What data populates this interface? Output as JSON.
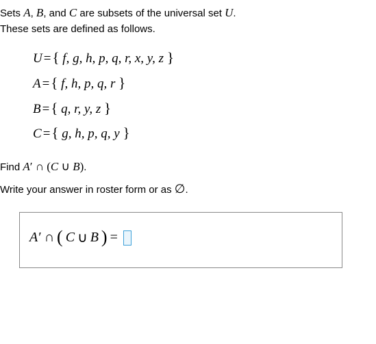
{
  "intro": {
    "line1_pre": "Sets ",
    "A": "A",
    "sep1": ", ",
    "B": "B",
    "sep2": ", and ",
    "C": "C",
    "line1_post": " are subsets of the universal set ",
    "U": "U",
    "period": ".",
    "line2": "These sets are defined as follows."
  },
  "sets": {
    "U": {
      "name": "U",
      "eq": "=",
      "lb": "{",
      "elems": " f, g, h, p, q, r, x, y, z ",
      "rb": "}"
    },
    "A": {
      "name": "A",
      "eq": "=",
      "lb": "{",
      "elems": " f, h, p, q, r ",
      "rb": "}"
    },
    "B": {
      "name": "B",
      "eq": "=",
      "lb": "{",
      "elems": " q, r, y, z ",
      "rb": "}"
    },
    "C": {
      "name": "C",
      "eq": "=",
      "lb": "{",
      "elems": " g, h, p, q, y ",
      "rb": "}"
    }
  },
  "prompt": {
    "find_pre": "Find ",
    "expr_A": "A",
    "prime": "′",
    "cap": " ∩ ",
    "lpar": "(",
    "expr_C": "C",
    "cup": " ∪ ",
    "expr_B": "B",
    "rpar": ")",
    "period": ".",
    "instr_pre": "Write your answer in roster form or as ",
    "empty": "∅",
    "instr_post": "."
  },
  "answer": {
    "A": "A",
    "prime": "′",
    "cap": "∩",
    "lpar": "(",
    "C": "C",
    "cup": "∪",
    "B": "B",
    "rpar": ")",
    "eq": "="
  }
}
